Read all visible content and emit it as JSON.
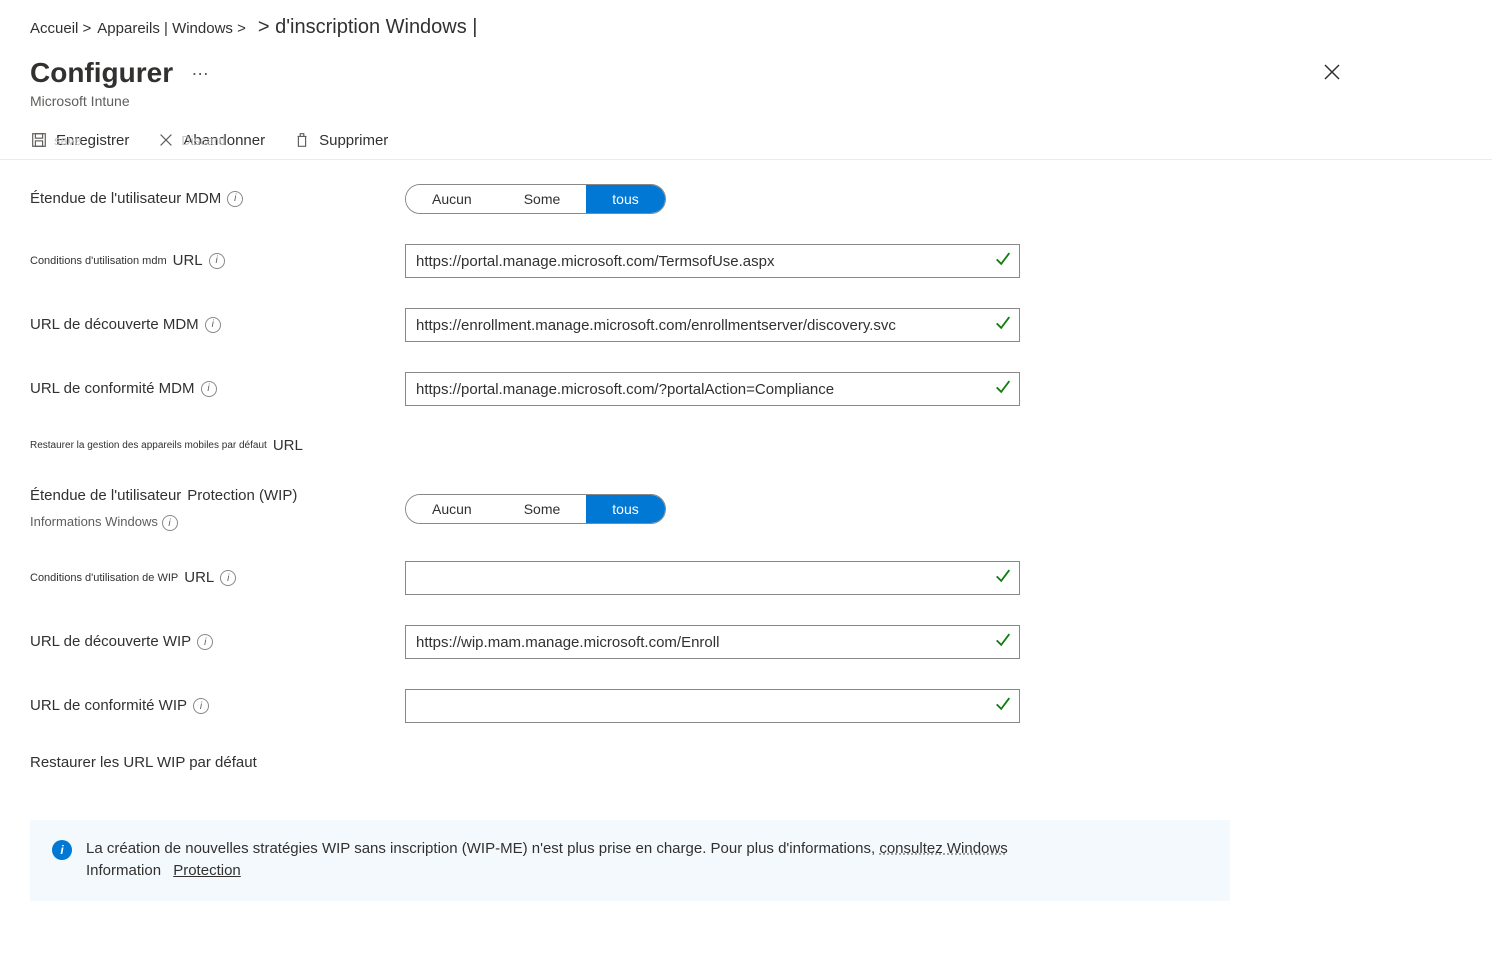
{
  "breadcrumb": {
    "b1": "Accueil &gt;",
    "b2": "Appareils | Windows &gt;",
    "b3": "&gt; d'inscription Windows |"
  },
  "header": {
    "title": "Configurer",
    "subtitle": "Microsoft Intune",
    "dots": "…"
  },
  "toolbar": {
    "save": "Enregistrer",
    "save_ghost": "save",
    "discard": "Abandonner",
    "discard_ghost": "Discard",
    "delete": "Supprimer"
  },
  "form": {
    "mdm_scope_label": "Étendue de l'utilisateur MDM",
    "seg_none": "Aucun",
    "seg_some": "Some",
    "seg_all": "tous",
    "mdm_terms_small": "Conditions d'utilisation mdm",
    "url_word": "URL",
    "mdm_terms_val": "https://portal.manage.microsoft.com/TermsofUse.aspx",
    "mdm_disc_label": "URL de découverte MDM",
    "mdm_disc_val": "https://enrollment.manage.microsoft.com/enrollmentserver/discovery.svc",
    "mdm_comp_label": "URL de conformité MDM",
    "mdm_comp_val": "https://portal.manage.microsoft.com/?portalAction=Compliance",
    "restore_mdm_small": "Restaurer la gestion des appareils mobiles par défaut",
    "wip_scope_l1": "Étendue de l'utilisateur",
    "wip_scope_l2": "Protection (WIP)",
    "wip_scope_l3": "Informations Windows",
    "wip_terms_small": "Conditions d'utilisation de WIP",
    "wip_terms_val": "",
    "wip_disc_label": "URL de découverte WIP",
    "wip_disc_val": "https://wip.mam.manage.microsoft.com/Enroll",
    "wip_comp_label": "URL de conformité WIP",
    "wip_comp_val": "",
    "restore_wip": "Restaurer les URL WIP par défaut"
  },
  "banner": {
    "text1": "La création de nouvelles stratégies WIP sans inscription (WIP-ME) n'est plus prise en charge. Pour plus d'informations, ",
    "link1": "consultez Windows",
    "text2": "Information",
    "link2": "Protection"
  }
}
